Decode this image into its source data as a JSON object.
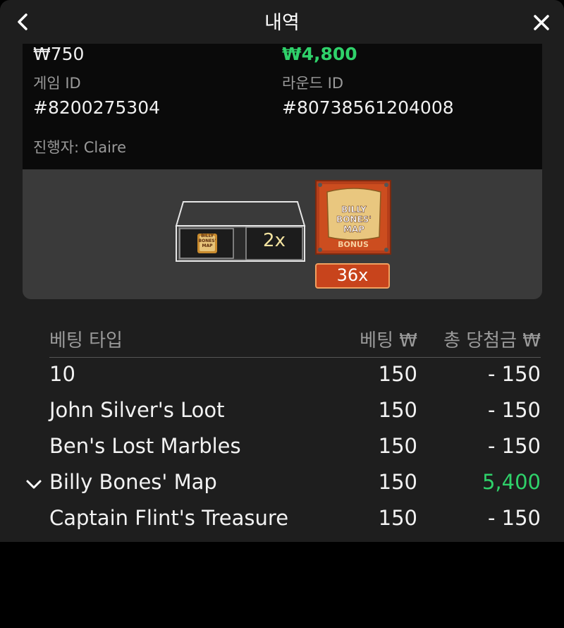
{
  "header": {
    "title": "내역"
  },
  "summary": {
    "bet_amount": "₩750",
    "win_amount": "₩4,800",
    "game_id_label": "게임 ID",
    "game_id": "#8200275304",
    "round_id_label": "라운드 ID",
    "round_id": "#80738561204008",
    "dealer": "진행자: Claire"
  },
  "game_result": {
    "chest_symbol_text": "BILLY BONES' MAP",
    "chest_multiplier": "2x",
    "bonus_card_title": "BILLY BONES' MAP",
    "bonus_label": "BONUS",
    "bonus_multiplier": "36x"
  },
  "bet_table": {
    "headers": {
      "type": "베팅 타입",
      "bet": "베팅 ₩",
      "total_win": "총 당첨금 ₩"
    },
    "rows": [
      {
        "type": "10",
        "bet": "150",
        "win": "- 150"
      },
      {
        "type": "John Silver's Loot",
        "bet": "150",
        "win": "- 150"
      },
      {
        "type": "Ben's Lost Marbles",
        "bet": "150",
        "win": "- 150"
      },
      {
        "type": "Billy Bones' Map",
        "bet": "150",
        "win": "5,400"
      },
      {
        "type": "Captain Flint's Treasure",
        "bet": "150",
        "win": "- 150"
      }
    ]
  },
  "colors": {
    "win_green": "#2fd16a",
    "panel_bg": "#1e1e1e",
    "bonus_orange": "#c8441c"
  }
}
